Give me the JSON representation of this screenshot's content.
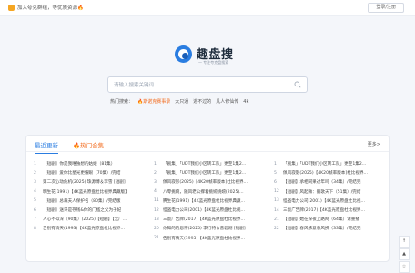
{
  "topbar": {
    "notice": "加入夸克群组，等优质资源🔥",
    "login_label": "登录/注册"
  },
  "logo": {
    "name": "趣盘搜",
    "slogan": "— 专注夸克盘搜索"
  },
  "search": {
    "placeholder": "请输入搜索关键词",
    "icon": "search-icon"
  },
  "hot": {
    "label": "热门搜索：",
    "items": [
      "🔥斯诺克赛事录",
      "大只通",
      "逃不过的",
      "凡人修仙传",
      "4k"
    ]
  },
  "panel": {
    "tab_recent": "最近更新",
    "tab_fav": "热门合集",
    "more": "更多>",
    "col1": [
      {
        "n": "1",
        "t": "【短剧】你是我唯独想的姑娘（81集）"
      },
      {
        "n": "2",
        "t": "【短剧】爱你比星光更耀眼（70集）/完结"
      },
      {
        "n": "3",
        "t": "第二次心动危机(2025) 珠源博＆李雪 [短剧]"
      },
      {
        "n": "4",
        "t": "明生花(1991)【4K蓝光原盘杜比视界典藏版】"
      },
      {
        "n": "5",
        "t": "【短剧】总裁夫人保护名（80集）/完结版"
      },
      {
        "n": "6",
        "t": "【短剧】送牙是存钱&你的门槛之父为子妃"
      },
      {
        "n": "7",
        "t": "人心不似深（90集）(2025)【短剧】【无厂..."
      },
      {
        "n": "8",
        "t": "告别有情天(1993)【4K蓝光原盘杜比视界..."
      }
    ],
    "col2": [
      {
        "n": "1",
        "t": "「剧集」「UDT我们小区转工队」更至1集2..."
      },
      {
        "n": "2",
        "t": "「剧集」「UDT我们小区转工队」更至1集2..."
      },
      {
        "n": "3",
        "t": "佩风寂影(2025)【4K20帧率版本]杜比视界..."
      },
      {
        "n": "4",
        "t": "八零挑婉，随风老公撑着挑婉挑婉(2025)..."
      },
      {
        "n": "11",
        "t": "腾生花(1991)【4K蓝光原盘杜比视界典藏..."
      },
      {
        "n": "12",
        "t": "怪盗电力公司(2001)【4K蓝光原盘杜比视..."
      },
      {
        "n": "13",
        "t": "三饭广告牌(2017)【4K蓝光原盘杜比视界..."
      },
      {
        "n": "20",
        "t": "你知的的恩怀(2025) 李行特＆曹碧刚 [短剧]"
      },
      {
        "n": "21",
        "t": "告别有情天(1993)【4K蓝光原盘杜比视界..."
      }
    ],
    "col3": [
      {
        "n": "1",
        "t": "「剧集」「UDT我们小区转工队」更至1集2..."
      },
      {
        "n": "5",
        "t": "佩风寂影(2025)【4K20帧率版本]杜比视界..."
      },
      {
        "n": "6",
        "t": "【短剧】承相同果过年吗（34集）/完结完"
      },
      {
        "n": "12",
        "t": "【短剧】风起微：鹅歌天下（51集）/完结"
      },
      {
        "n": "13",
        "t": "怪盗电力公司(2001)【4K蓝光原盘杜比视..."
      },
      {
        "n": "14",
        "t": "三饭广告牌(2017)【4K蓝光原盘杜比视界..."
      },
      {
        "n": "21",
        "t": "【短剧】她在深夜上路网（64集）请重播"
      },
      {
        "n": "22",
        "t": "【短剧】春风拂意春风拂（33集）/完结完"
      }
    ]
  },
  "float_buttons": [
    "↑",
    "▲",
    "☆"
  ]
}
